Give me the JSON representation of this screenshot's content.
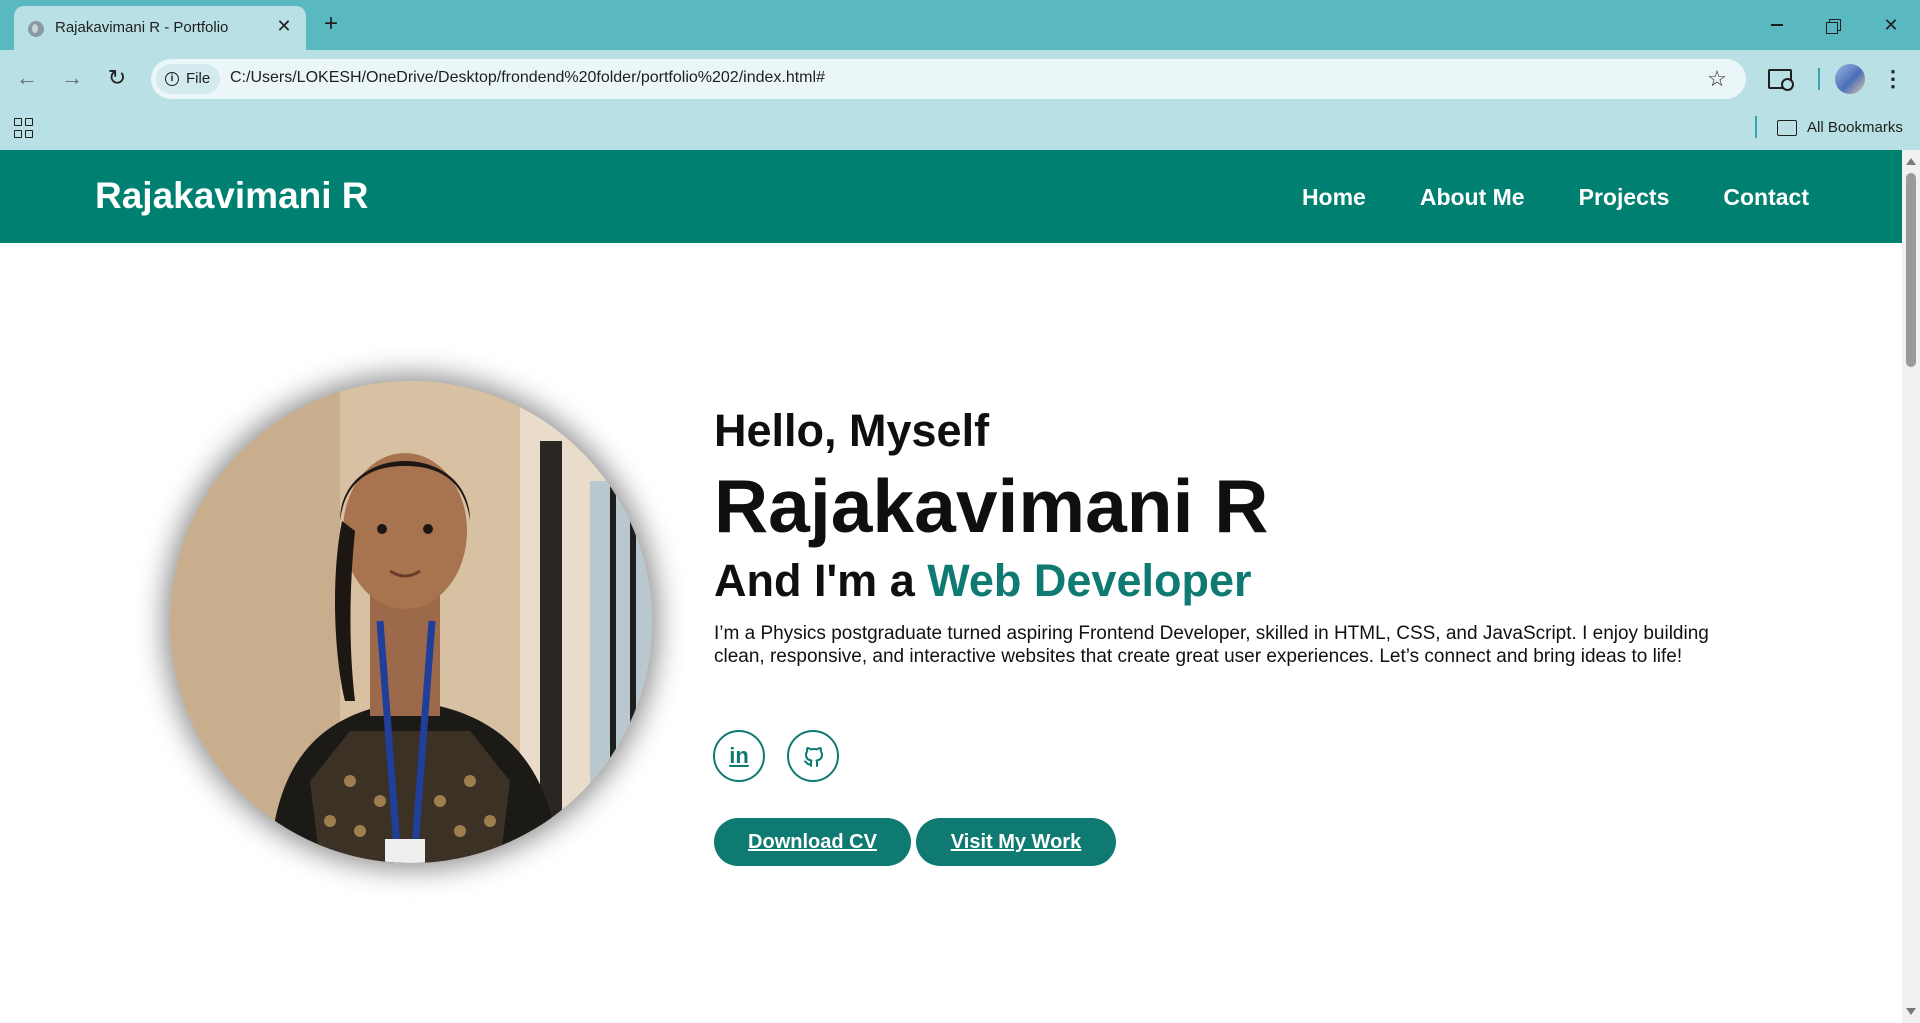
{
  "browser": {
    "tab": {
      "title": "Rajakavimani R - Portfolio"
    },
    "address": {
      "chip_label": "File",
      "url": "C:/Users/LOKESH/OneDrive/Desktop/frondend%20folder/portfolio%202/index.html#"
    },
    "bookmarks": {
      "all_bookmarks_label": "All Bookmarks"
    }
  },
  "site": {
    "logo": "Rajakavimani R",
    "nav": [
      {
        "label": "Home"
      },
      {
        "label": "About Me"
      },
      {
        "label": "Projects"
      },
      {
        "label": "Contact"
      }
    ],
    "hero": {
      "greeting": "Hello, Myself",
      "name": "Rajakavimani R",
      "role_prefix": "And I'm a ",
      "role": "Web Developer",
      "bio": "I’m a Physics postgraduate turned aspiring Frontend Developer, skilled in HTML, CSS, and JavaScript. I enjoy building clean, responsive, and interactive websites that create great user experiences. Let’s connect and bring ideas to life!",
      "social": [
        {
          "icon": "linkedin-icon",
          "glyph": "in"
        },
        {
          "icon": "github-icon"
        }
      ],
      "buttons": {
        "download_cv": "Download CV",
        "visit_work": "Visit My Work"
      }
    },
    "colors": {
      "header": "#008071",
      "accent": "#0f7a71",
      "tabstrip": "#5ab8c1",
      "toolbar": "#b9e1e5"
    }
  }
}
